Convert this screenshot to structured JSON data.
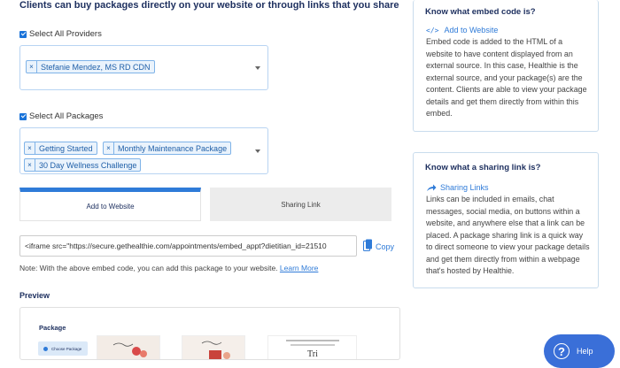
{
  "heading": "Clients can buy packages directly on your website or through links that you share",
  "providers": {
    "select_all_label": "Select All Providers",
    "tags": [
      "Stefanie Mendez, MS RD CDN"
    ]
  },
  "packages": {
    "select_all_label": "Select All Packages",
    "tags": [
      "Getting Started",
      "Monthly Maintenance Package",
      "30 Day Wellness Challenge"
    ]
  },
  "tabs": {
    "add_to_website": "Add to Website",
    "sharing_link": "Sharing Link"
  },
  "embed": {
    "code": "<iframe src=\"https://secure.gethealthie.com/appointments/embed_appt?dietitian_id=21510",
    "copy_label": "Copy",
    "note_text": "Note: With the above embed code, you can add this package to your website.",
    "learn_more": "Learn More"
  },
  "preview": {
    "title": "Preview",
    "package_label": "Package",
    "choose_package": "Choose Package",
    "thumb_text": "Tri"
  },
  "embed_card": {
    "title": "Know what embed code is?",
    "link_label": "Add to Website",
    "body": "Embed code is added to the HTML of a website to have content displayed from an external source. In this case, Healthie is the external source, and your package(s) are the content. Clients are able to view your package details and get them directly from within this embed."
  },
  "sharing_card": {
    "title": "Know what a sharing link is?",
    "link_label": "Sharing Links",
    "body": "Links can be included in emails, chat messages, social media, on buttons within a website, and anywhere else that a link can be placed. A package sharing link is a quick way to direct someone to view your package details and get them directly from within a webpage that's hosted by Healthie."
  },
  "help": {
    "label": "Help"
  },
  "colors": {
    "accent": "#2f7bd8",
    "navy": "#1f3160",
    "help_bg": "#3a6fd8"
  },
  "icons": {
    "embed": "code-icon",
    "sharing": "share-arrow-icon",
    "copy": "copy-icon",
    "help": "question-icon"
  }
}
